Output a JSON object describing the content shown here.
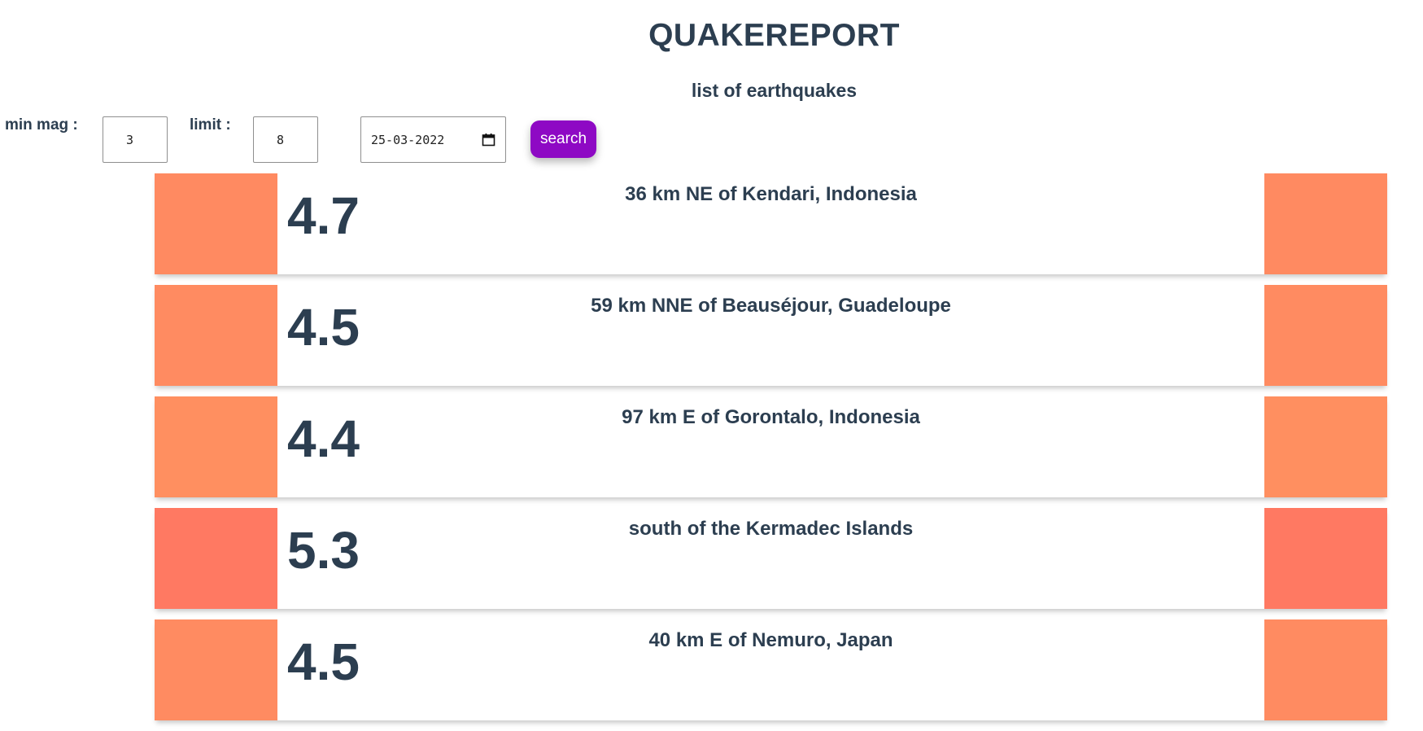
{
  "header": {
    "title": "QUAKEREPORT",
    "subtitle": "list of earthquakes"
  },
  "filters": {
    "min_mag_label": "min mag :",
    "min_mag_value": "3",
    "limit_label": "limit :",
    "limit_value": "8",
    "date_value": "25-03-2022",
    "search_label": "search",
    "calendar_icon": "calendar-icon",
    "search_button_color": "#8e09c4"
  },
  "quakes": [
    {
      "mag": "4.7",
      "place": "36 km NE of Kendari, Indonesia",
      "color": "#ff8a61"
    },
    {
      "mag": "4.5",
      "place": "59 km NNE of Beauséjour, Guadeloupe",
      "color": "#ff8b61"
    },
    {
      "mag": "4.4",
      "place": "97 km E of Gorontalo, Indonesia",
      "color": "#ff8f60"
    },
    {
      "mag": "5.3",
      "place": "south of the Kermadec Islands",
      "color": "#ff7962"
    },
    {
      "mag": "4.5",
      "place": "40 km E of Nemuro, Japan",
      "color": "#ff8b61"
    }
  ]
}
